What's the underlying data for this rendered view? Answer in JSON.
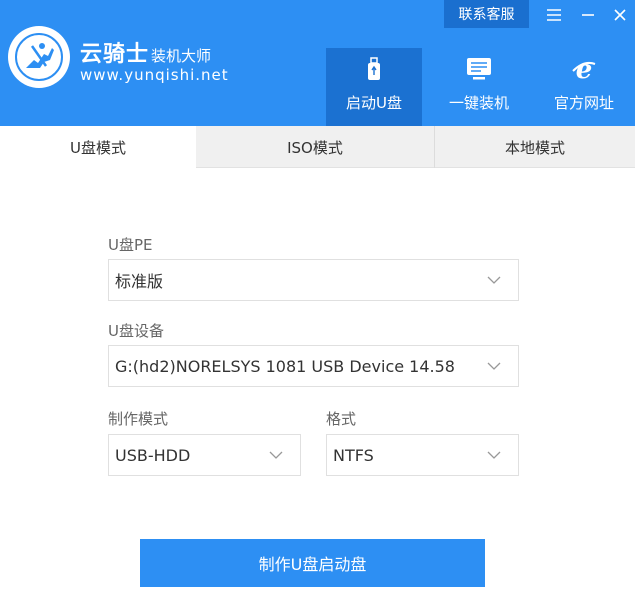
{
  "header": {
    "brand_name": "云骑士",
    "brand_suffix": "装机大师",
    "brand_url": "www.yunqishi.net",
    "contact_label": "联系客服",
    "nav": [
      {
        "label": "启动U盘",
        "icon": "usb-drive-icon",
        "active": true
      },
      {
        "label": "一键装机",
        "icon": "monitor-icon",
        "active": false
      },
      {
        "label": "官方网址",
        "icon": "ie-browser-icon",
        "active": false
      }
    ]
  },
  "tabs": [
    {
      "label": "U盘模式",
      "active": true
    },
    {
      "label": "ISO模式",
      "active": false
    },
    {
      "label": "本地模式",
      "active": false
    }
  ],
  "form": {
    "pe": {
      "label": "U盘PE",
      "value": "标准版"
    },
    "device": {
      "label": "U盘设备",
      "value": "G:(hd2)NORELSYS 1081 USB Device 14.58"
    },
    "mode": {
      "label": "制作模式",
      "value": "USB-HDD"
    },
    "format": {
      "label": "格式",
      "value": "NTFS"
    }
  },
  "create_button": "制作U盘启动盘",
  "colors": {
    "primary": "#2d8ff3",
    "active_nav": "#1b71d1",
    "contact_bg": "#1a6fcf"
  }
}
